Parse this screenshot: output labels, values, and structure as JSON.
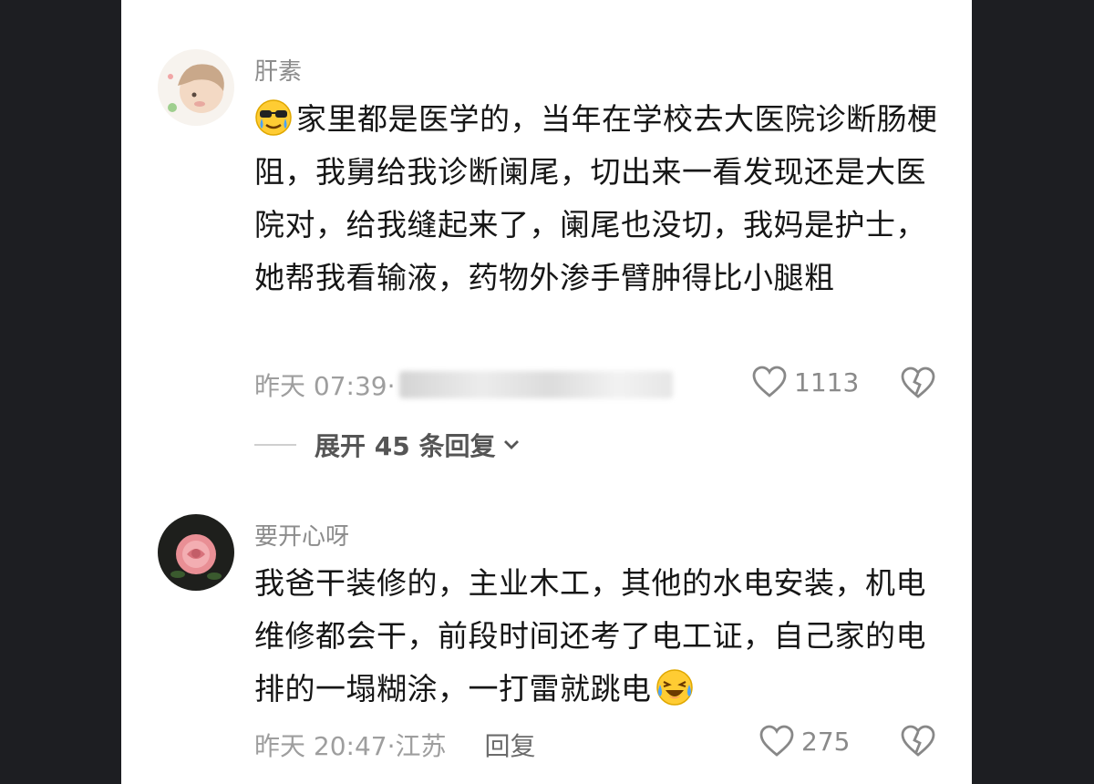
{
  "comments": [
    {
      "username": "肝素",
      "avatar_icon": "cartoon-child-avatar-icon",
      "emoji_icon": "cool-crying-face-icon",
      "text": "家里都是医学的，当年在学校去大医院诊断肠梗阻，我舅给我诊断阑尾，切出来一看发现还是大医院对，给我缝起来了，阑尾也没切，我妈是护士，她帮我看输液，药物外渗手臂肿得比小腿粗",
      "time": "昨天 07:39·",
      "likes": "1113",
      "expand_label": "展开 45 条回复"
    },
    {
      "username": "要开心呀",
      "avatar_icon": "pink-rose-avatar-icon",
      "text": "我爸干装修的，主业木工，其他的水电安装，机电维修都会干，前段时间还考了电工证，自己家的电排的一塌糊涂，一打雷就跳电",
      "emoji_icon": "laughing-crying-face-icon",
      "time": "昨天 20:47·江苏",
      "reply_label": "回复",
      "likes": "275"
    }
  ],
  "colors": {
    "background": "#1d1e22",
    "panel": "#ffffff",
    "text": "#161616",
    "meta": "#9e9e9e"
  }
}
